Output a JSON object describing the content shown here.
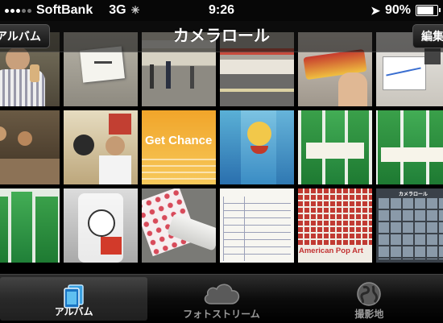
{
  "status_bar": {
    "carrier": "SoftBank",
    "network": "3G",
    "time": "9:26",
    "battery": "90%",
    "battery_level": 0.9
  },
  "nav_bar": {
    "title": "カメラロール",
    "back_button": "アルバム",
    "edit_button": "編集"
  },
  "grid": {
    "photos": [
      {
        "subject": "man-with-drink"
      },
      {
        "subject": "note-card"
      },
      {
        "subject": "train-station-concourse"
      },
      {
        "subject": "station-platform"
      },
      {
        "subject": "garigari-kun-ice-in-hand"
      },
      {
        "subject": "chart-on-screen"
      },
      {
        "subject": "izakaya-party"
      },
      {
        "subject": "restaurant-group"
      },
      {
        "subject": "get-chance-poster",
        "text": "Get Chance"
      },
      {
        "subject": "garigari-kun-packages"
      },
      {
        "subject": "green-snack-packages"
      },
      {
        "subject": "green-snack-packages-2"
      },
      {
        "subject": "green-snack-bags"
      },
      {
        "subject": "plastic-bag-character"
      },
      {
        "subject": "polka-dot-stapler"
      },
      {
        "subject": "handwritten-form"
      },
      {
        "subject": "american-pop-art-ticket",
        "text": "American Pop Art"
      },
      {
        "subject": "camera-roll-screenshot",
        "text": "カメラロール"
      }
    ]
  },
  "tab_bar": {
    "tabs": [
      {
        "label": "アルバム",
        "icon": "albums-icon",
        "selected": true
      },
      {
        "label": "フォトストリーム",
        "icon": "cloud-icon",
        "selected": false
      },
      {
        "label": "撮影地",
        "icon": "globe-icon",
        "selected": false
      }
    ]
  }
}
